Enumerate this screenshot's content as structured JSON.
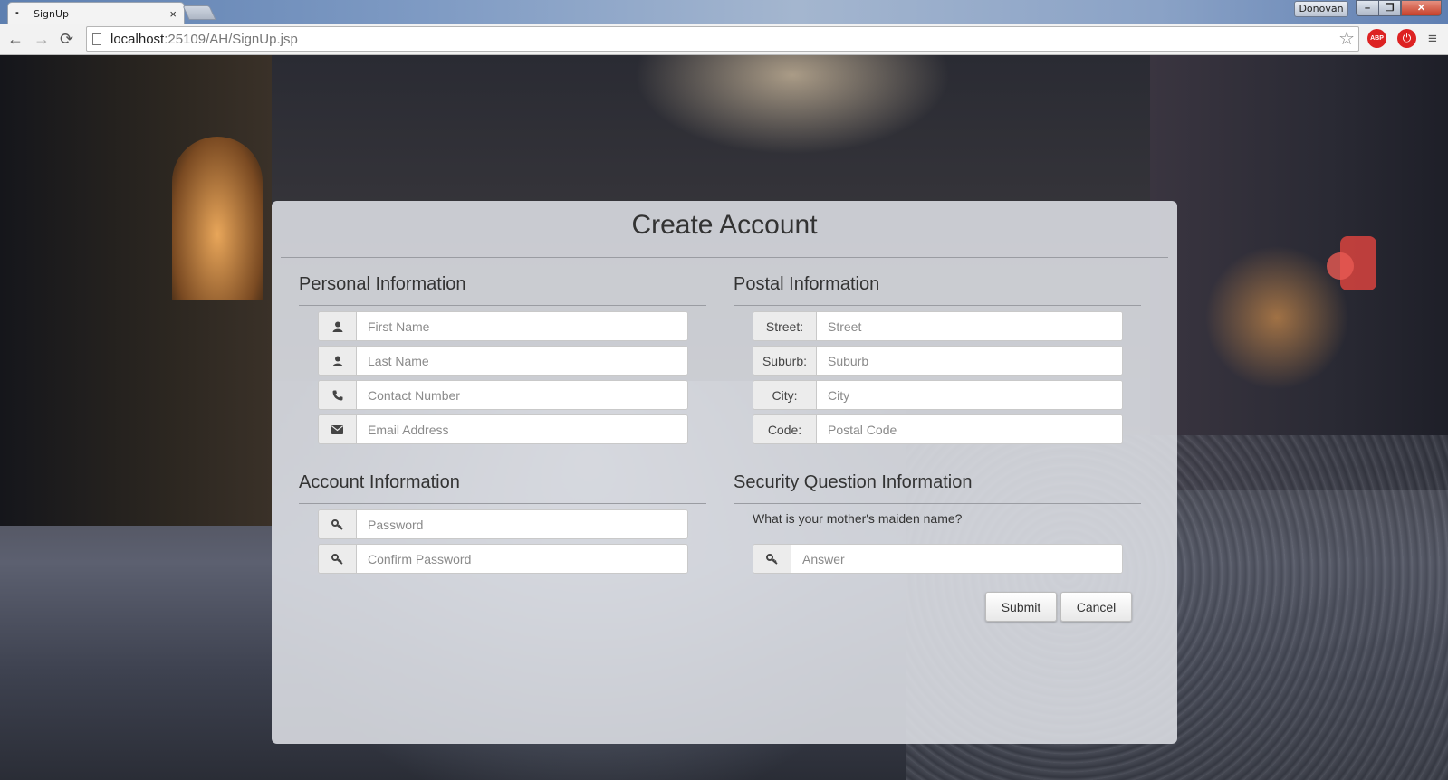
{
  "browser": {
    "tab_title": "SignUp",
    "tab_close": "×",
    "profile_name": "Donovan",
    "window_controls": {
      "minimize": "–",
      "maximize": "❐",
      "close": "✕"
    },
    "nav": {
      "back": "←",
      "forward": "→",
      "reload": "⟳"
    },
    "url_host": "localhost",
    "url_path": ":25109/AH/SignUp.jsp",
    "bookmark_star": "☆",
    "extension_abp": "ABP",
    "extension_power": "⏻",
    "menu": "≡"
  },
  "form": {
    "title": "Create Account",
    "personal": {
      "heading": "Personal Information",
      "fields": [
        {
          "icon": "user-icon",
          "placeholder": "First Name"
        },
        {
          "icon": "user-icon",
          "placeholder": "Last Name"
        },
        {
          "icon": "phone-icon",
          "placeholder": "Contact Number"
        },
        {
          "icon": "envelope-icon",
          "placeholder": "Email Address"
        }
      ]
    },
    "postal": {
      "heading": "Postal Information",
      "fields": [
        {
          "label": "Street:",
          "placeholder": "Street"
        },
        {
          "label": "Suburb:",
          "placeholder": "Suburb"
        },
        {
          "label": "City:",
          "placeholder": "City"
        },
        {
          "label": "Code:",
          "placeholder": "Postal Code"
        }
      ]
    },
    "account": {
      "heading": "Account Information",
      "fields": [
        {
          "icon": "key-icon",
          "placeholder": "Password"
        },
        {
          "icon": "key-icon",
          "placeholder": "Confirm Password"
        }
      ]
    },
    "security": {
      "heading": "Security Question Information",
      "question": "What is your mother's maiden name?",
      "answer_placeholder": "Answer",
      "answer_icon": "key-icon"
    },
    "buttons": {
      "submit": "Submit",
      "cancel": "Cancel"
    }
  }
}
